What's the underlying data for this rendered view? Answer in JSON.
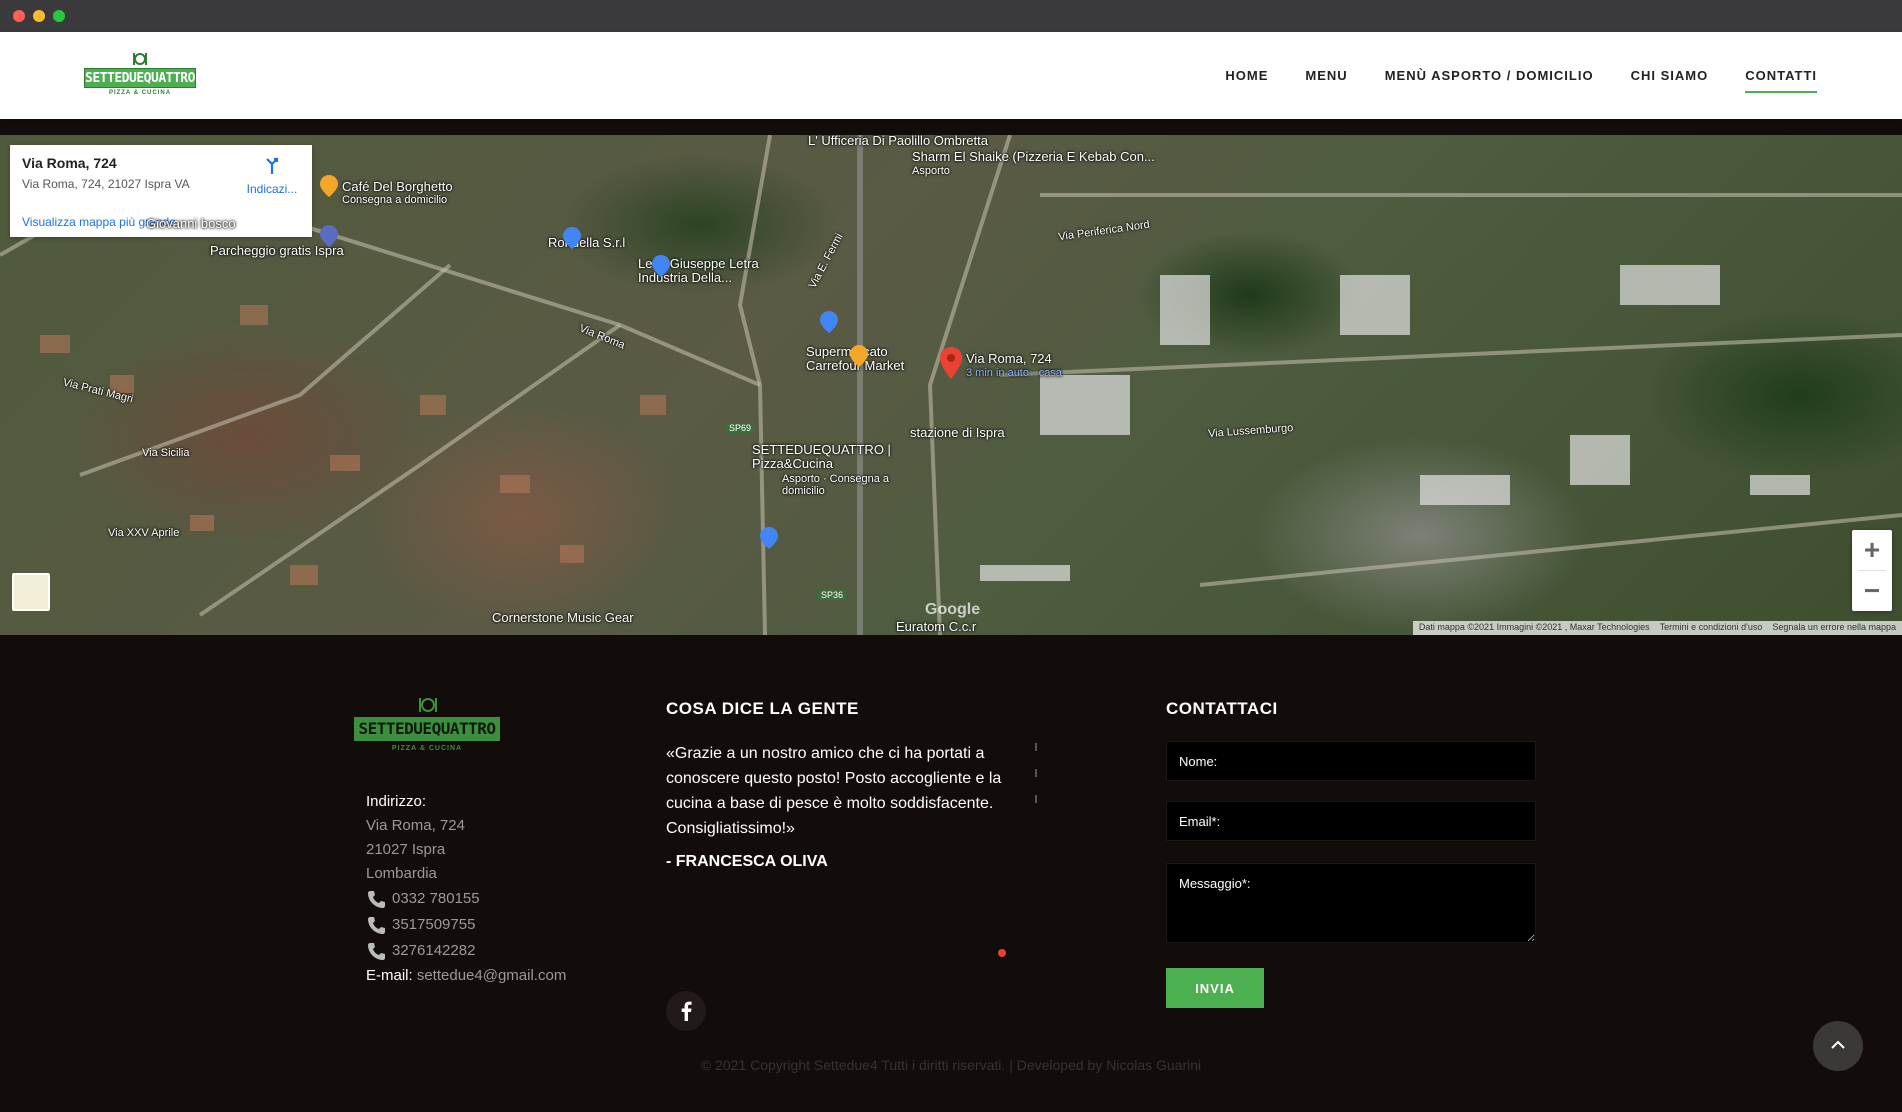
{
  "nav": {
    "items": [
      "HOME",
      "MENU",
      "MENÙ ASPORTO / DOMICILIO",
      "CHI SIAMO",
      "CONTATTI"
    ],
    "active": "CONTATTI"
  },
  "brand": {
    "name": "SETTEDUEQUATTRO",
    "tagline": "PIZZA & CUCINA"
  },
  "map": {
    "info_title": "Via Roma, 724",
    "info_address": "Via Roma, 724, 21027 Ispra VA",
    "info_directions": "Indicazi...",
    "info_larger_map": "Visualizza mappa più grande",
    "marker_label": "Via Roma, 724",
    "marker_sub": "3 min in auto - casa",
    "labels": [
      "L' Ufficeria Di Paolillo Ombretta",
      "Sharm El Shaike (Pizzeria E Kebab Con...",
      "Asporto",
      "Café Del Borghetto",
      "Consegna a domicilio",
      "Giovanni bosco",
      "Parcheggio gratis Ispra",
      "Rondella S.r.l",
      "Leva Giuseppe Letra Industria Della...",
      "Supermercato Carrefour Market",
      "stazione di Ispra",
      "SETTEDUEQUATTRO | Pizza&Cucina",
      "Asporto · Consegna a domicilio",
      "Cornerstone Music Gear",
      "Euratom C.c.r",
      "Via Roma",
      "Via E. Fermi",
      "Via Periferica Nord",
      "Via Lussemburgo",
      "Via Sicilia",
      "Via XXV Aprile",
      "Via Prati Magri",
      "SP69",
      "SP36"
    ],
    "zoom_in": "+",
    "zoom_out": "−",
    "attribution": [
      "Dati mappa ©2021 Immagini ©2021 , Maxar Technologies",
      "Termini e condizioni d'uso",
      "Segnala un errore nella mappa"
    ]
  },
  "footer": {
    "address_label": "Indirizzo:",
    "address_lines": [
      "Via Roma, 724",
      "21027 Ispra",
      "Lombardia"
    ],
    "phones": [
      "0332 780155",
      "3517509755",
      "3276142282"
    ],
    "email_label": "E-mail:",
    "email": "settedue4@gmail.com",
    "reviews_title": "COSA DICE LA GENTE",
    "review_text": "«Grazie a un nostro amico che ci ha portati a conoscere questo posto! Posto accogliente e la cucina a base di pesce è molto soddisfacente. Consigliatissimo!»",
    "review_author": "- FRANCESCA OLIVA",
    "contact_title": "CONTATTACI",
    "name_placeholder": "Nome:",
    "email_placeholder": "Email*:",
    "message_placeholder": "Messaggio*:",
    "submit_label": "INVIA",
    "copyright": "© 2021 Copyright Settedue4 Tutti i diritti riservati. | Developed by Nicolas Guarini"
  },
  "colors": {
    "accent": "#4caf50",
    "footer_bg": "#120c0b",
    "bullet": "#e8412d"
  }
}
